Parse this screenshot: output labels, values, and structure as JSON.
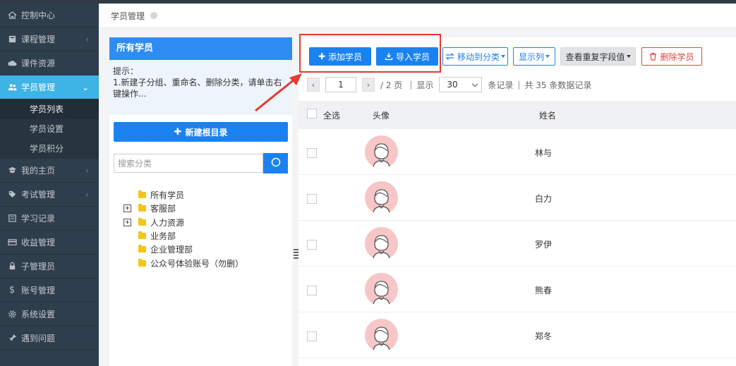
{
  "sidebar": {
    "items": [
      {
        "label": "控制中心",
        "icon": "home-icon",
        "expandable": false
      },
      {
        "label": "课程管理",
        "icon": "book-icon",
        "expandable": true
      },
      {
        "label": "课件资源",
        "icon": "cloud-icon",
        "expandable": false
      },
      {
        "label": "学员管理",
        "icon": "users-icon",
        "expandable": true,
        "active": true
      },
      {
        "label": "我的主页",
        "icon": "graduation-cap-icon",
        "expandable": true
      },
      {
        "label": "考试管理",
        "icon": "tag-icon",
        "expandable": true
      },
      {
        "label": "学习记录",
        "icon": "record-icon",
        "expandable": false
      },
      {
        "label": "收益管理",
        "icon": "credit-card-icon",
        "expandable": false
      },
      {
        "label": "子管理员",
        "icon": "lock-icon",
        "expandable": false
      },
      {
        "label": "账号管理",
        "icon": "dollar-icon",
        "expandable": false
      },
      {
        "label": "系统设置",
        "icon": "gear-icon",
        "expandable": false
      },
      {
        "label": "遇到问题",
        "icon": "pin-icon",
        "expandable": false
      }
    ],
    "sub_items": [
      "学员列表",
      "学员设置",
      "学员积分"
    ]
  },
  "breadcrumb": {
    "title": "学员管理"
  },
  "left_panel": {
    "header": "所有学员",
    "tip_title": "提示：",
    "tip_text": "1.新建子分组、重命名、删除分类，请单击右键操作...",
    "new_root_button": "新建根目录",
    "search_placeholder": "搜索分类",
    "tree": [
      {
        "label": "所有学员",
        "toggle": ""
      },
      {
        "label": "客服部",
        "toggle": "+"
      },
      {
        "label": "人力资源",
        "toggle": "+"
      },
      {
        "label": "业务部",
        "toggle": ""
      },
      {
        "label": "企业管理部",
        "toggle": ""
      },
      {
        "label": "公众号体验账号（勿删）",
        "toggle": ""
      }
    ]
  },
  "toolbar": {
    "add_student": "添加学员",
    "import_student": "导入学员",
    "move_to_category": "移动到分类",
    "show_columns": "显示列",
    "check_duplicates": "查看重复字段值",
    "delete_student": "删除学员"
  },
  "pager": {
    "current_page": "1",
    "total_pages": "/ 2 页",
    "show_label": "显示",
    "page_size": "30",
    "records_label": "条记录",
    "total_records": "共 35 条数据记录"
  },
  "table": {
    "headers": {
      "select_all": "全选",
      "avatar": "头像",
      "name": "姓名"
    },
    "rows": [
      {
        "name": "林与"
      },
      {
        "name": "白力"
      },
      {
        "name": "罗伊"
      },
      {
        "name": "熊春"
      },
      {
        "name": "郑冬"
      }
    ]
  },
  "colors": {
    "accent": "#1a82f0",
    "active_nav": "#3db3e6",
    "danger": "#e5463b",
    "highlight": "#e63a2e"
  }
}
